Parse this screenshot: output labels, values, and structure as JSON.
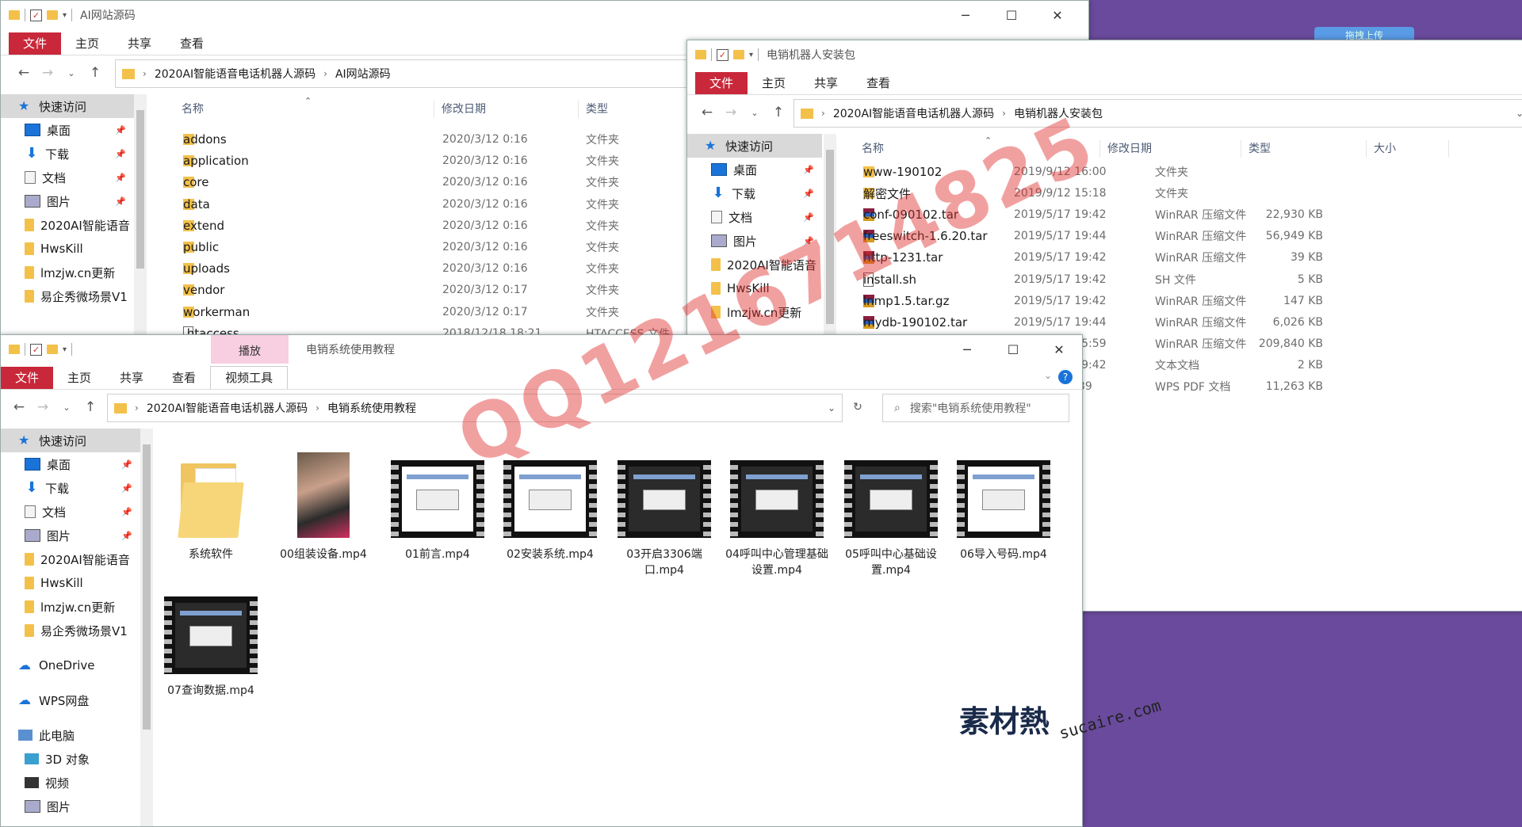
{
  "desktop": {
    "cloud_button": "拖拽上传"
  },
  "win1": {
    "title": "AI网站源码",
    "ribbon_tabs": [
      "文件",
      "主页",
      "共享",
      "查看"
    ],
    "breadcrumb": [
      "2020AI智能语音电话机器人源码",
      "AI网站源码"
    ],
    "nav": [
      {
        "label": "快速访问",
        "icon": "star-icon"
      },
      {
        "label": "桌面",
        "icon": "desktop-icon",
        "pinned": true
      },
      {
        "label": "下载",
        "icon": "download-icon",
        "pinned": true
      },
      {
        "label": "文档",
        "icon": "document-icon",
        "pinned": true
      },
      {
        "label": "图片",
        "icon": "picture-icon",
        "pinned": true
      },
      {
        "label": "2020AI智能语音",
        "icon": "folder-icon"
      },
      {
        "label": "HwsKill",
        "icon": "folder-icon"
      },
      {
        "label": "lmzjw.cn更新",
        "icon": "folder-icon"
      },
      {
        "label": "易企秀微场景V1",
        "icon": "folder-icon"
      }
    ],
    "columns": {
      "name": "名称",
      "date": "修改日期",
      "type": "类型"
    },
    "files": [
      {
        "name": "addons",
        "date": "2020/3/12 0:16",
        "type": "文件夹",
        "icon": "folder-icon"
      },
      {
        "name": "application",
        "date": "2020/3/12 0:16",
        "type": "文件夹",
        "icon": "folder-icon"
      },
      {
        "name": "core",
        "date": "2020/3/12 0:16",
        "type": "文件夹",
        "icon": "folder-icon"
      },
      {
        "name": "data",
        "date": "2020/3/12 0:16",
        "type": "文件夹",
        "icon": "folder-icon"
      },
      {
        "name": "extend",
        "date": "2020/3/12 0:16",
        "type": "文件夹",
        "icon": "folder-icon"
      },
      {
        "name": "public",
        "date": "2020/3/12 0:16",
        "type": "文件夹",
        "icon": "folder-icon"
      },
      {
        "name": "uploads",
        "date": "2020/3/12 0:16",
        "type": "文件夹",
        "icon": "folder-icon"
      },
      {
        "name": "vendor",
        "date": "2020/3/12 0:17",
        "type": "文件夹",
        "icon": "folder-icon"
      },
      {
        "name": "workerman",
        "date": "2020/3/12 0:17",
        "type": "文件夹",
        "icon": "folder-icon"
      },
      {
        "name": ".htaccess",
        "date": "2018/12/18 18:21",
        "type": "HTACCESS 文件",
        "icon": "text-file-icon"
      }
    ]
  },
  "win2": {
    "title": "电销机器人安装包",
    "ribbon_tabs": [
      "文件",
      "主页",
      "共享",
      "查看"
    ],
    "breadcrumb": [
      "2020AI智能语音电话机器人源码",
      "电销机器人安装包"
    ],
    "nav": [
      {
        "label": "快速访问",
        "icon": "star-icon"
      },
      {
        "label": "桌面",
        "icon": "desktop-icon",
        "pinned": true
      },
      {
        "label": "下载",
        "icon": "download-icon",
        "pinned": true
      },
      {
        "label": "文档",
        "icon": "document-icon",
        "pinned": true
      },
      {
        "label": "图片",
        "icon": "picture-icon",
        "pinned": true
      },
      {
        "label": "2020AI智能语音",
        "icon": "folder-icon"
      },
      {
        "label": "HwsKill",
        "icon": "folder-icon"
      },
      {
        "label": "lmzjw.cn更新",
        "icon": "folder-icon"
      }
    ],
    "columns": {
      "name": "名称",
      "date": "修改日期",
      "type": "类型",
      "size": "大小"
    },
    "files": [
      {
        "name": "www-190102",
        "date": "2019/9/12 16:00",
        "type": "文件夹",
        "size": "",
        "icon": "folder-icon"
      },
      {
        "name": "解密文件",
        "date": "2019/9/12 15:18",
        "type": "文件夹",
        "size": "",
        "icon": "folder-icon"
      },
      {
        "name": "conf-090102.tar",
        "date": "2019/5/17 19:42",
        "type": "WinRAR 压缩文件",
        "size": "22,930 KB",
        "icon": "winrar-icon"
      },
      {
        "name": "freeswitch-1.6.20.tar",
        "date": "2019/5/17 19:44",
        "type": "WinRAR 压缩文件",
        "size": "56,949 KB",
        "icon": "winrar-icon"
      },
      {
        "name": "http-1231.tar",
        "date": "2019/5/17 19:42",
        "type": "WinRAR 压缩文件",
        "size": "39 KB",
        "icon": "winrar-icon"
      },
      {
        "name": "install.sh",
        "date": "2019/5/17 19:42",
        "type": "SH 文件",
        "size": "5 KB",
        "icon": "text-file-icon"
      },
      {
        "name": "lnmp1.5.tar.gz",
        "date": "2019/5/17 19:42",
        "type": "WinRAR 压缩文件",
        "size": "147 KB",
        "icon": "winrar-icon"
      },
      {
        "name": "mydb-190102.tar",
        "date": "2019/5/17 19:44",
        "type": "WinRAR 压缩文件",
        "size": "6,026 KB",
        "icon": "winrar-icon"
      },
      {
        "name": "",
        "date": "2019/9/12 15:59",
        "type": "WinRAR 压缩文件",
        "size": "209,840 KB",
        "icon": ""
      },
      {
        "name": "",
        "date": "2019/5/17 19:42",
        "type": "文本文档",
        "size": "2 KB",
        "icon": ""
      },
      {
        "name": "",
        "date": "2019/9/3 9:39",
        "type": "WPS PDF 文档",
        "size": "11,263 KB",
        "icon": ""
      }
    ]
  },
  "win3": {
    "title": "电销系统使用教程",
    "context_tab": "播放",
    "ribbon_tabs": [
      "文件",
      "主页",
      "共享",
      "查看",
      "视频工具"
    ],
    "breadcrumb": [
      "2020AI智能语音电话机器人源码",
      "电销系统使用教程"
    ],
    "search_placeholder": "搜索\"电销系统使用教程\"",
    "nav": [
      {
        "label": "快速访问",
        "icon": "star-icon"
      },
      {
        "label": "桌面",
        "icon": "desktop-icon",
        "pinned": true
      },
      {
        "label": "下载",
        "icon": "download-icon",
        "pinned": true
      },
      {
        "label": "文档",
        "icon": "document-icon",
        "pinned": true
      },
      {
        "label": "图片",
        "icon": "picture-icon",
        "pinned": true
      },
      {
        "label": "2020AI智能语音",
        "icon": "folder-icon"
      },
      {
        "label": "HwsKill",
        "icon": "folder-icon"
      },
      {
        "label": "lmzjw.cn更新",
        "icon": "folder-icon"
      },
      {
        "label": "易企秀微场景V1",
        "icon": "folder-icon"
      },
      {
        "label": "OneDrive",
        "icon": "onedrive-icon"
      },
      {
        "label": "WPS网盘",
        "icon": "cloud-icon"
      },
      {
        "label": "此电脑",
        "icon": "computer-icon"
      },
      {
        "label": "3D 对象",
        "icon": "3d-objects-icon"
      },
      {
        "label": "视频",
        "icon": "video-icon"
      },
      {
        "label": "图片",
        "icon": "picture-icon"
      }
    ],
    "items": [
      {
        "name": "系统软件",
        "kind": "folder"
      },
      {
        "name": "00组装设备.mp4",
        "kind": "photo"
      },
      {
        "name": "01前言.mp4",
        "kind": "video"
      },
      {
        "name": "02安装系统.mp4",
        "kind": "video"
      },
      {
        "name": "03开启3306端口.mp4",
        "kind": "video-dark"
      },
      {
        "name": "04呼叫中心管理基础设置.mp4",
        "kind": "video-dark"
      },
      {
        "name": "05呼叫中心基础设置.mp4",
        "kind": "video-dark"
      },
      {
        "name": "06导入号码.mp4",
        "kind": "video"
      },
      {
        "name": "07查询数据.mp4",
        "kind": "video-dark"
      }
    ]
  },
  "watermark": "QQ1216714825",
  "logo": {
    "mark": "素材熱",
    "url": "sucaire.com"
  }
}
